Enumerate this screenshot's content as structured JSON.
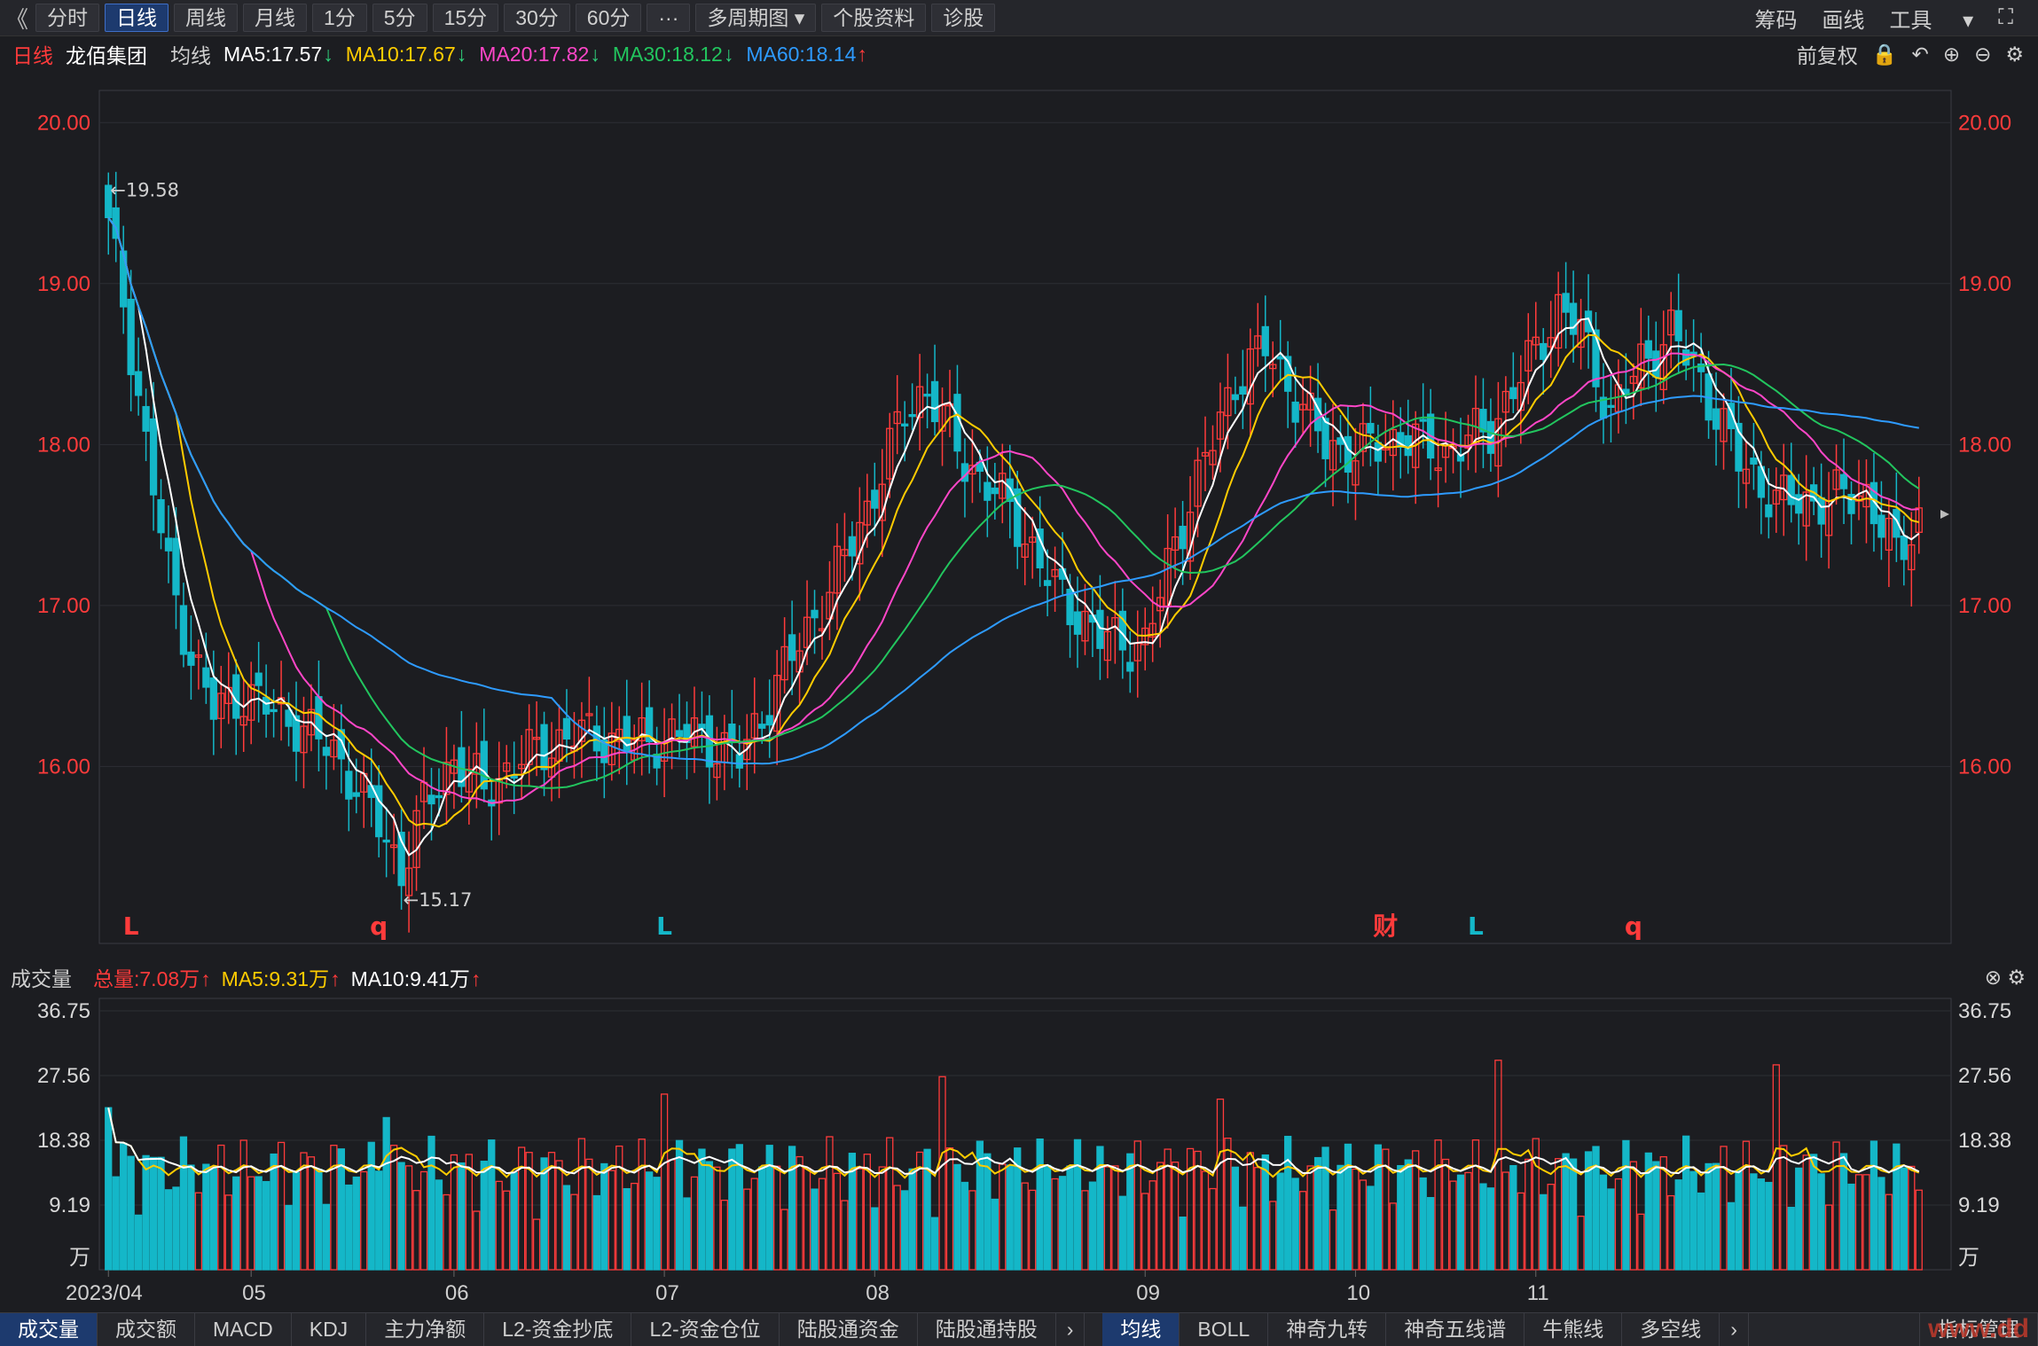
{
  "toolbar": {
    "back": "《",
    "periods": [
      "分时",
      "日线",
      "周线",
      "月线",
      "1分",
      "5分",
      "15分",
      "30分",
      "60分"
    ],
    "more": "···",
    "multi_period": "多周期图",
    "stock_info": "个股资料",
    "diagnose": "诊股",
    "right": [
      "筹码",
      "画线",
      "工具"
    ],
    "active_period": "日线"
  },
  "header": {
    "period": "日线",
    "stock_name": "龙佰集团",
    "indicator": "均线",
    "ma5": "MA5:17.57",
    "ma10": "MA10:17.67",
    "ma20": "MA20:17.82",
    "ma30": "MA30:18.12",
    "ma60": "MA60:18.14",
    "adjust": "前复权"
  },
  "colors": {
    "up": "#ff3b3b",
    "down": "#14b7c8",
    "ma5": "#ffffff",
    "ma10": "#ffcc00",
    "ma20": "#ff46c8",
    "ma30": "#22c55e",
    "ma60": "#2e9bff",
    "axis_label": "#ff3b3b"
  },
  "chart_data": [
    {
      "type": "candlestick",
      "title": "日线",
      "y_ticks": [
        "20.00",
        "19.00",
        "18.00",
        "17.00",
        "16.00"
      ],
      "ylim": [
        14.9,
        20.2
      ],
      "markers": [
        {
          "label": "L",
          "color": "#ff3b3b"
        },
        {
          "label": "q",
          "color": "#ff3b3b"
        },
        {
          "label": "L",
          "color": "#14b7c8"
        },
        {
          "label": "财",
          "color": "#ff3b3b"
        },
        {
          "label": "L",
          "color": "#14b7c8"
        },
        {
          "label": "q",
          "color": "#ff3b3b"
        }
      ],
      "annotations": [
        "←19.58",
        "←15.17"
      ],
      "series": [
        {
          "name": "MA5",
          "color": "#ffffff"
        },
        {
          "name": "MA10",
          "color": "#ffcc00"
        },
        {
          "name": "MA20",
          "color": "#ff46c8"
        },
        {
          "name": "MA30",
          "color": "#22c55e"
        },
        {
          "name": "MA60",
          "color": "#2e9bff"
        }
      ]
    },
    {
      "type": "bar",
      "title": "成交量",
      "y_ticks": [
        "36.75",
        "27.56",
        "18.38",
        "9.19"
      ],
      "unit": "万",
      "ylim": [
        0,
        36.75
      ],
      "x_ticks": [
        "2023/04",
        "05",
        "06",
        "07",
        "08",
        "09",
        "10",
        "11"
      ]
    }
  ],
  "volume_header": {
    "title": "成交量",
    "total": "总量:7.08万",
    "ma5": "MA5:9.31万",
    "ma10": "MA10:9.41万"
  },
  "bottom_tabs": [
    "成交量",
    "成交额",
    "MACD",
    "KDJ",
    "主力净额",
    "L2-资金抄底",
    "L2-资金仓位",
    "陆股通资金",
    "陆股通持股"
  ],
  "bottom_tabs2": [
    "均线",
    "BOLL",
    "神奇九转",
    "神奇五线谱",
    "牛熊线",
    "多空线"
  ],
  "bottom_right": "指标管理",
  "watermark": "www.dd"
}
